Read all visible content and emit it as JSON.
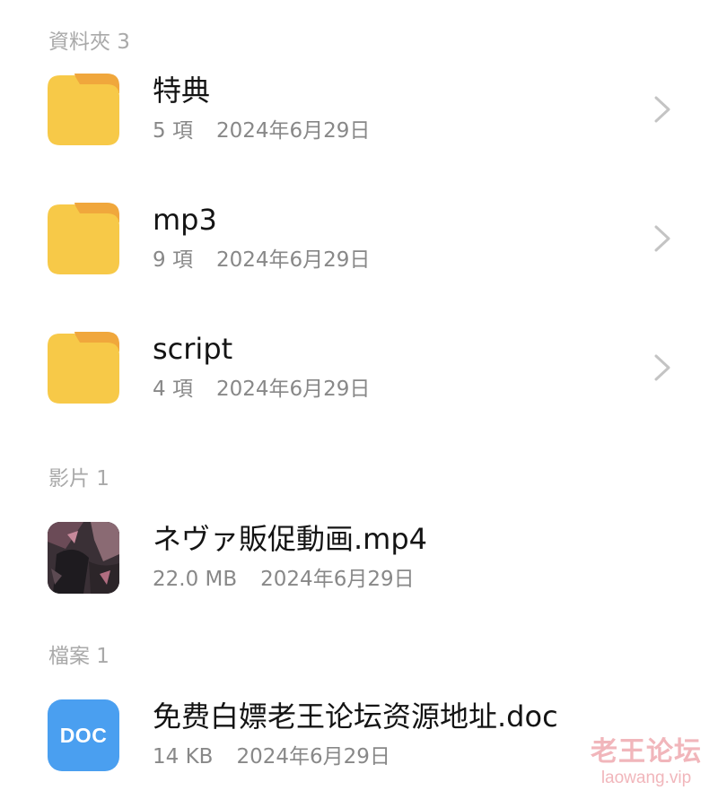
{
  "sections": {
    "folders": {
      "header": "資料夾 3",
      "items": [
        {
          "name": "特典",
          "count": "5 項",
          "date": "2024年6月29日",
          "icon": "folder-icon"
        },
        {
          "name": "mp3",
          "count": "9 項",
          "date": "2024年6月29日",
          "icon": "folder-icon"
        },
        {
          "name": "script",
          "count": "4 項",
          "date": "2024年6月29日",
          "icon": "folder-icon"
        }
      ]
    },
    "videos": {
      "header": "影片 1",
      "items": [
        {
          "name": "ネヴァ販促動画.mp4",
          "size": "22.0 MB",
          "date": "2024年6月29日",
          "icon": "video-thumbnail"
        }
      ]
    },
    "files": {
      "header": "檔案 1",
      "items": [
        {
          "name": "免费白嫖老王论坛资源地址.doc",
          "size": "14 KB",
          "date": "2024年6月29日",
          "icon": "doc-icon",
          "badge": "DOC"
        }
      ]
    }
  },
  "watermark": {
    "title": "老王论坛",
    "url": "laowang.vip"
  },
  "colors": {
    "folder_body": "#f7c948",
    "folder_tab": "#f0a73c",
    "doc_icon_bg": "#4a9ff0",
    "header_text": "#a9a9a9",
    "meta_text": "#888888",
    "chevron": "#c4c4c4"
  }
}
